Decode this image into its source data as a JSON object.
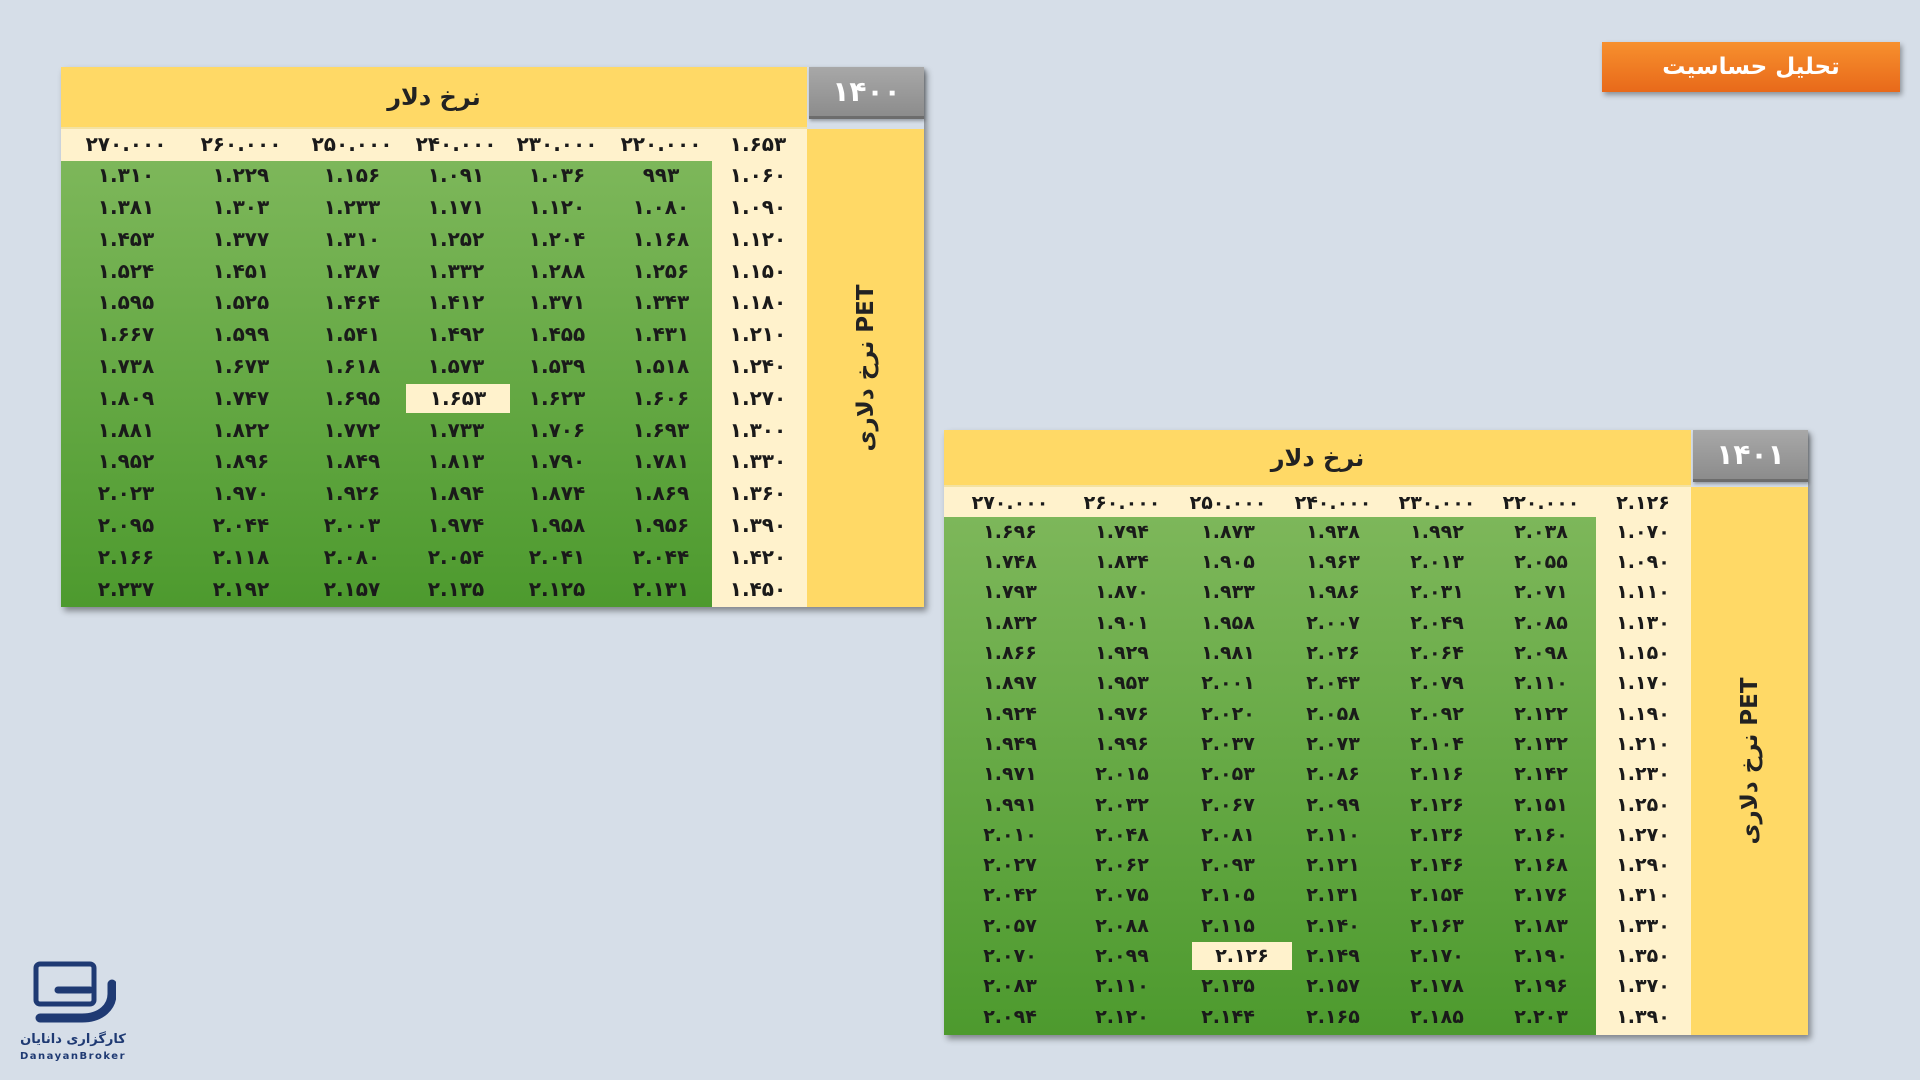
{
  "title": "تحلیل حساسیت",
  "logo": {
    "name_fa": "کارگزاری دانایان",
    "name_en": "DanayanBroker"
  },
  "tables": [
    {
      "year": "۱۴۰۰",
      "top_label": "نرخ دلار",
      "side_label": "نرخ دلاری PET",
      "corner": "۱.۶۵۳",
      "highlight": [
        7,
        3
      ],
      "columns": [
        "۲۷۰.۰۰۰",
        "۲۶۰.۰۰۰",
        "۲۵۰.۰۰۰",
        "۲۴۰.۰۰۰",
        "۲۳۰.۰۰۰",
        "۲۲۰.۰۰۰"
      ],
      "row_labels": [
        "۱.۰۶۰",
        "۱.۰۹۰",
        "۱.۱۲۰",
        "۱.۱۵۰",
        "۱.۱۸۰",
        "۱.۲۱۰",
        "۱.۲۴۰",
        "۱.۲۷۰",
        "۱.۳۰۰",
        "۱.۳۳۰",
        "۱.۳۶۰",
        "۱.۳۹۰",
        "۱.۴۲۰",
        "۱.۴۵۰"
      ],
      "rows": [
        [
          "۱.۳۱۰",
          "۱.۲۲۹",
          "۱.۱۵۶",
          "۱.۰۹۱",
          "۱.۰۳۶",
          "۹۹۳"
        ],
        [
          "۱.۳۸۱",
          "۱.۳۰۳",
          "۱.۲۳۳",
          "۱.۱۷۱",
          "۱.۱۲۰",
          "۱.۰۸۰"
        ],
        [
          "۱.۴۵۳",
          "۱.۳۷۷",
          "۱.۳۱۰",
          "۱.۲۵۲",
          "۱.۲۰۴",
          "۱.۱۶۸"
        ],
        [
          "۱.۵۲۴",
          "۱.۴۵۱",
          "۱.۳۸۷",
          "۱.۳۳۲",
          "۱.۲۸۸",
          "۱.۲۵۶"
        ],
        [
          "۱.۵۹۵",
          "۱.۵۲۵",
          "۱.۴۶۴",
          "۱.۴۱۲",
          "۱.۳۷۱",
          "۱.۳۴۳"
        ],
        [
          "۱.۶۶۷",
          "۱.۵۹۹",
          "۱.۵۴۱",
          "۱.۴۹۲",
          "۱.۴۵۵",
          "۱.۴۳۱"
        ],
        [
          "۱.۷۳۸",
          "۱.۶۷۳",
          "۱.۶۱۸",
          "۱.۵۷۳",
          "۱.۵۳۹",
          "۱.۵۱۸"
        ],
        [
          "۱.۸۰۹",
          "۱.۷۴۷",
          "۱.۶۹۵",
          "۱.۶۵۳",
          "۱.۶۲۳",
          "۱.۶۰۶"
        ],
        [
          "۱.۸۸۱",
          "۱.۸۲۲",
          "۱.۷۷۲",
          "۱.۷۳۳",
          "۱.۷۰۶",
          "۱.۶۹۳"
        ],
        [
          "۱.۹۵۲",
          "۱.۸۹۶",
          "۱.۸۴۹",
          "۱.۸۱۳",
          "۱.۷۹۰",
          "۱.۷۸۱"
        ],
        [
          "۲.۰۲۳",
          "۱.۹۷۰",
          "۱.۹۲۶",
          "۱.۸۹۴",
          "۱.۸۷۴",
          "۱.۸۶۹"
        ],
        [
          "۲.۰۹۵",
          "۲.۰۴۴",
          "۲.۰۰۳",
          "۱.۹۷۴",
          "۱.۹۵۸",
          "۱.۹۵۶"
        ],
        [
          "۲.۱۶۶",
          "۲.۱۱۸",
          "۲.۰۸۰",
          "۲.۰۵۴",
          "۲.۰۴۱",
          "۲.۰۴۴"
        ],
        [
          "۲.۲۳۷",
          "۲.۱۹۲",
          "۲.۱۵۷",
          "۲.۱۳۵",
          "۲.۱۲۵",
          "۲.۱۳۱"
        ]
      ]
    },
    {
      "year": "۱۴۰۱",
      "top_label": "نرخ دلار",
      "side_label": "نرخ دلاری PET",
      "corner": "۲.۱۲۶",
      "highlight": [
        14,
        2
      ],
      "columns": [
        "۲۷۰.۰۰۰",
        "۲۶۰.۰۰۰",
        "۲۵۰.۰۰۰",
        "۲۴۰.۰۰۰",
        "۲۳۰.۰۰۰",
        "۲۲۰.۰۰۰"
      ],
      "row_labels": [
        "۱.۰۷۰",
        "۱.۰۹۰",
        "۱.۱۱۰",
        "۱.۱۳۰",
        "۱.۱۵۰",
        "۱.۱۷۰",
        "۱.۱۹۰",
        "۱.۲۱۰",
        "۱.۲۳۰",
        "۱.۲۵۰",
        "۱.۲۷۰",
        "۱.۲۹۰",
        "۱.۳۱۰",
        "۱.۳۳۰",
        "۱.۳۵۰",
        "۱.۳۷۰",
        "۱.۳۹۰"
      ],
      "rows": [
        [
          "۱.۶۹۶",
          "۱.۷۹۴",
          "۱.۸۷۳",
          "۱.۹۳۸",
          "۱.۹۹۲",
          "۲.۰۳۸"
        ],
        [
          "۱.۷۴۸",
          "۱.۸۳۴",
          "۱.۹۰۵",
          "۱.۹۶۳",
          "۲.۰۱۳",
          "۲.۰۵۵"
        ],
        [
          "۱.۷۹۳",
          "۱.۸۷۰",
          "۱.۹۳۳",
          "۱.۹۸۶",
          "۲.۰۳۱",
          "۲.۰۷۱"
        ],
        [
          "۱.۸۳۲",
          "۱.۹۰۱",
          "۱.۹۵۸",
          "۲.۰۰۷",
          "۲.۰۴۹",
          "۲.۰۸۵"
        ],
        [
          "۱.۸۶۶",
          "۱.۹۲۹",
          "۱.۹۸۱",
          "۲.۰۲۶",
          "۲.۰۶۴",
          "۲.۰۹۸"
        ],
        [
          "۱.۸۹۷",
          "۱.۹۵۳",
          "۲.۰۰۱",
          "۲.۰۴۳",
          "۲.۰۷۹",
          "۲.۱۱۰"
        ],
        [
          "۱.۹۲۴",
          "۱.۹۷۶",
          "۲.۰۲۰",
          "۲.۰۵۸",
          "۲.۰۹۲",
          "۲.۱۲۲"
        ],
        [
          "۱.۹۴۹",
          "۱.۹۹۶",
          "۲.۰۳۷",
          "۲.۰۷۳",
          "۲.۱۰۴",
          "۲.۱۳۲"
        ],
        [
          "۱.۹۷۱",
          "۲.۰۱۵",
          "۲.۰۵۳",
          "۲.۰۸۶",
          "۲.۱۱۶",
          "۲.۱۴۲"
        ],
        [
          "۱.۹۹۱",
          "۲.۰۳۲",
          "۲.۰۶۷",
          "۲.۰۹۹",
          "۲.۱۲۶",
          "۲.۱۵۱"
        ],
        [
          "۲.۰۱۰",
          "۲.۰۴۸",
          "۲.۰۸۱",
          "۲.۱۱۰",
          "۲.۱۳۶",
          "۲.۱۶۰"
        ],
        [
          "۲.۰۲۷",
          "۲.۰۶۲",
          "۲.۰۹۳",
          "۲.۱۲۱",
          "۲.۱۴۶",
          "۲.۱۶۸"
        ],
        [
          "۲.۰۴۲",
          "۲.۰۷۵",
          "۲.۱۰۵",
          "۲.۱۳۱",
          "۲.۱۵۴",
          "۲.۱۷۶"
        ],
        [
          "۲.۰۵۷",
          "۲.۰۸۸",
          "۲.۱۱۵",
          "۲.۱۴۰",
          "۲.۱۶۳",
          "۲.۱۸۳"
        ],
        [
          "۲.۰۷۰",
          "۲.۰۹۹",
          "۲.۱۲۶",
          "۲.۱۴۹",
          "۲.۱۷۰",
          "۲.۱۹۰"
        ],
        [
          "۲.۰۸۳",
          "۲.۱۱۰",
          "۲.۱۳۵",
          "۲.۱۵۷",
          "۲.۱۷۸",
          "۲.۱۹۶"
        ],
        [
          "۲.۰۹۴",
          "۲.۱۲۰",
          "۲.۱۴۴",
          "۲.۱۶۵",
          "۲.۱۸۵",
          "۲.۲۰۳"
        ]
      ]
    }
  ]
}
